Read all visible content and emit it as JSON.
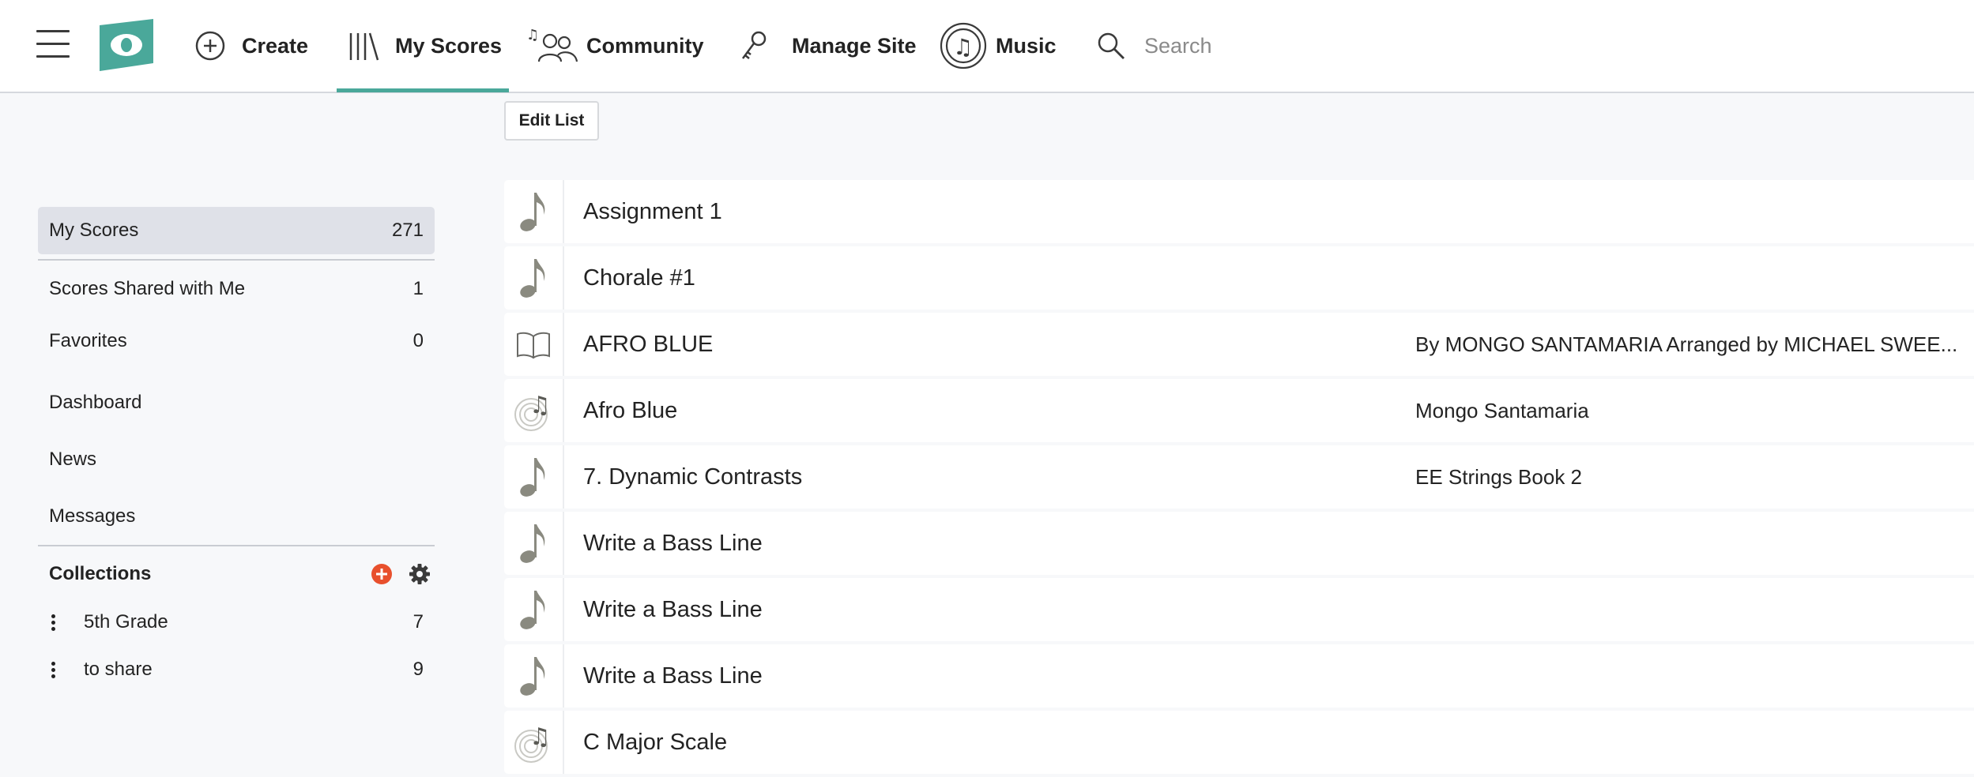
{
  "nav": {
    "menu_icon": "hamburger-icon",
    "logo_icon": "noteflight-logo",
    "items": [
      {
        "label": "Create",
        "icon": "plus-circle-icon"
      },
      {
        "label": "My Scores",
        "icon": "library-icon"
      },
      {
        "label": "Community",
        "icon": "community-icon"
      },
      {
        "label": "Manage Site",
        "icon": "key-icon"
      },
      {
        "label": "Music",
        "icon": "music-disc-icon"
      }
    ],
    "active_item": "My Scores",
    "accent_color": "#4aa89a",
    "search": {
      "placeholder": "Search",
      "value": "",
      "icon": "search-icon"
    }
  },
  "toolbar": {
    "edit_list_label": "Edit List"
  },
  "sidebar": {
    "items": [
      {
        "label": "My Scores",
        "count": "271",
        "active": true
      },
      {
        "label": "Scores Shared with Me",
        "count": "1"
      },
      {
        "label": "Favorites",
        "count": "0"
      },
      {
        "label": "Dashboard",
        "count": ""
      },
      {
        "label": "News",
        "count": ""
      },
      {
        "label": "Messages",
        "count": ""
      }
    ],
    "collections": {
      "title": "Collections",
      "add_icon": "add-collection-icon",
      "add_color": "#e8502d",
      "settings_icon": "gear-icon",
      "items": [
        {
          "label": "5th Grade",
          "count": "7"
        },
        {
          "label": "to share",
          "count": "9"
        }
      ]
    }
  },
  "scores": [
    {
      "title": "Assignment 1",
      "subtitle": "",
      "icon": "eighth-note-icon"
    },
    {
      "title": "Chorale #1",
      "subtitle": "",
      "icon": "eighth-note-icon"
    },
    {
      "title": "AFRO BLUE",
      "subtitle": "By MONGO SANTAMARIA Arranged by MICHAEL SWEE...",
      "icon": "book-icon"
    },
    {
      "title": "Afro Blue",
      "subtitle": "Mongo Santamaria",
      "icon": "audio-disc-icon"
    },
    {
      "title": "7. Dynamic Contrasts",
      "subtitle": "EE Strings Book 2",
      "icon": "eighth-note-icon"
    },
    {
      "title": "Write a Bass Line",
      "subtitle": "",
      "icon": "eighth-note-icon"
    },
    {
      "title": "Write a Bass Line",
      "subtitle": "",
      "icon": "eighth-note-icon"
    },
    {
      "title": "Write a Bass Line",
      "subtitle": "",
      "icon": "eighth-note-icon"
    },
    {
      "title": "C Major Scale",
      "subtitle": "",
      "icon": "audio-disc-icon"
    }
  ]
}
